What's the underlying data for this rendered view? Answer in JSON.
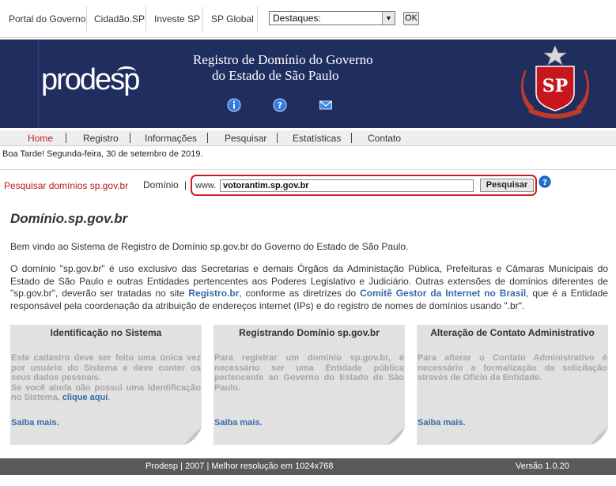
{
  "top_links": [
    "Portal do Governo",
    "Cidadão.SP",
    "Investe SP",
    "SP Global"
  ],
  "destaques": {
    "selected": "Destaques:",
    "ok_label": "OK"
  },
  "banner": {
    "logo_text": "prodesp",
    "title_line1": "Registro de Domínio do Governo",
    "title_line2": "do Estado de São Paulo",
    "icons": [
      "info-icon",
      "help-icon",
      "mail-icon"
    ],
    "seal_letters": "SP"
  },
  "nav": {
    "items": [
      "Home",
      "Registro",
      "Informações",
      "Pesquisar",
      "Estatísticas",
      "Contato"
    ],
    "active": "Home"
  },
  "greeting": "Boa Tarde! Segunda-feira, 30 de setembro de 2019.",
  "search": {
    "label": "Pesquisar domínios sp.gov.br",
    "dominio_label": "Domínio",
    "separator": "|",
    "prefix": "www.",
    "value": "votorantim.sp.gov.br",
    "button": "Pesquisar"
  },
  "main": {
    "title": "Domínio.sp.gov.br",
    "welcome": "Bem vindo ao Sistema de Registro de Domínio sp.gov.br do Governo do Estado de São Paulo.",
    "p2_a": "O domínio \"sp.gov.br\" é uso exclusivo das Secretarias e demais Órgãos da Administação Pública, Prefeituras e Câmaras Municipais do Estado de São Paulo e outras Entidades pertencentes aos Poderes Legislativo e Judiciário. Outras extensões de domínios diferentes de \"sp.gov.br\", deverão ser tratadas no site ",
    "p2_link1": "Registro.br",
    "p2_b": ", conforme as diretrizes do ",
    "p2_link2": "Comitê Gestor da Internet no Brasil",
    "p2_c": ", que é a Entidade responsável pela coordenação da atribuição de endereços internet (IPs) e do registro de nomes de domínios usando \".br\"."
  },
  "cards": [
    {
      "title": "Identificação no Sistema",
      "body": "Este cadastro deve ser feito uma única vez por usuário do Sistema e deve conter os seus dados pessoais.",
      "body2": "Se você ainda não possui uma identificação no Sistema, ",
      "link": "clique aqui",
      "more": "Saiba mais."
    },
    {
      "title": "Registrando Domínio sp.gov.br",
      "body": "Para registrar um domínio sp.gov.br, é necessário ser uma Entidade pública pertencente ao Governo do Estado de São Paulo.",
      "more": "Saiba mais."
    },
    {
      "title": "Alteração de Contato Administrativo",
      "body": "Para alterar o Contato Administrativo é necessário a formalização da solicitação através de Ofício da Entidade.",
      "more": "Saiba mais."
    }
  ],
  "footer": {
    "center": "Prodesp | 2007 | Melhor resolução em 1024x768",
    "version": "Versão 1.0.20"
  },
  "colors": {
    "banner": "#1f2e5f",
    "accent_red": "#bf1e1e",
    "link_blue": "#3a6aa8",
    "card_bg": "#e1e1e1",
    "footer_bg": "#5a5a5a"
  }
}
